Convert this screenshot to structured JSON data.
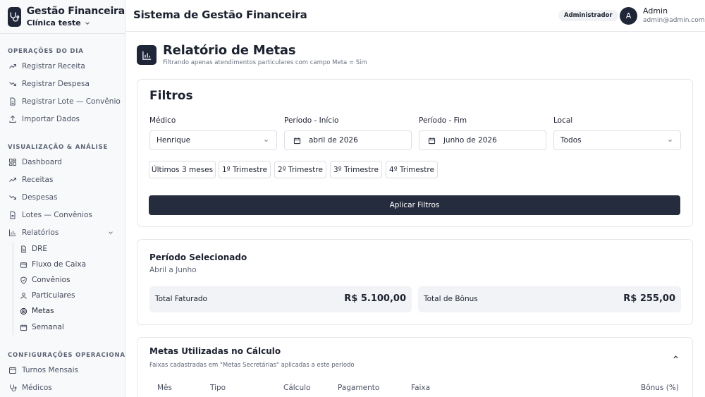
{
  "brand": {
    "title": "Gestão Financeira",
    "clinic": "Clínica teste"
  },
  "sidebar": {
    "sections": [
      {
        "title": "OPERAÇÕES DO DIA"
      },
      {
        "title": "VISUALIZAÇÃO & ANÁLISE"
      },
      {
        "title": "CONFIGURAÇÕES OPERACIONAIS"
      }
    ],
    "items": [
      {
        "label": "Registrar Receita",
        "icon": "trend-up-icon"
      },
      {
        "label": "Registrar Despesa",
        "icon": "trend-down-icon"
      },
      {
        "label": "Registrar Lote — Convênio",
        "icon": "file-icon"
      },
      {
        "label": "Importar Dados",
        "icon": "upload-icon"
      },
      {
        "label": "Dashboard",
        "icon": "grid-icon"
      },
      {
        "label": "Receitas",
        "icon": "trend-up-icon"
      },
      {
        "label": "Despesas",
        "icon": "trend-down-icon"
      },
      {
        "label": "Lotes — Convênios",
        "icon": "file-icon"
      },
      {
        "label": "Relatórios",
        "icon": "bar-chart-icon"
      },
      {
        "label": "Turnos Mensais",
        "icon": "calendar-icon"
      },
      {
        "label": "Médicos",
        "icon": "stethoscope-icon"
      }
    ],
    "reports": [
      {
        "label": "DRE",
        "icon": "file-text-icon"
      },
      {
        "label": "Fluxo de Caixa",
        "icon": "wallet-icon"
      },
      {
        "label": "Convênios",
        "icon": "shield-icon"
      },
      {
        "label": "Particulares",
        "icon": "user-icon"
      },
      {
        "label": "Metas",
        "icon": "target-icon"
      },
      {
        "label": "Semanal",
        "icon": "calendar-icon"
      }
    ]
  },
  "header": {
    "title": "Sistema de Gestão Financeira",
    "role": "Administrador",
    "avatar_initial": "A",
    "user_name": "Admin",
    "user_email": "admin@admin.com"
  },
  "page": {
    "title": "Relatório de Metas",
    "subtitle": "Filtrando apenas atendimentos particulares com campo Meta = Sim"
  },
  "filters": {
    "title": "Filtros",
    "medico": {
      "label": "Médico",
      "value": "Henrique"
    },
    "inicio": {
      "label": "Período - Início",
      "value": "abril de 2026"
    },
    "fim": {
      "label": "Período - Fim",
      "value": "junho de 2026"
    },
    "local": {
      "label": "Local",
      "value": "Todos"
    },
    "quick": [
      "Últimos 3 meses",
      "1º Trimestre",
      "2º Trimestre",
      "3º Trimestre",
      "4º Trimestre"
    ],
    "apply": "Aplicar Filtros"
  },
  "periodo": {
    "title": "Período Selecionado",
    "range": "Abril a Junho",
    "faturado_label": "Total Faturado",
    "faturado_value": "R$ 5.100,00",
    "bonus_label": "Total de Bônus",
    "bonus_value": "R$ 255,00"
  },
  "metas": {
    "title": "Metas Utilizadas no Cálculo",
    "subtitle": "Faixas cadastradas em \"Metas Secretárias\" aplicadas a este período",
    "columns": [
      "Mês",
      "Tipo",
      "Cálculo",
      "Pagamento",
      "Faixa",
      "Bônus (%)"
    ]
  },
  "colors": {
    "accent": "#1f2638",
    "button": "#252c3e"
  }
}
